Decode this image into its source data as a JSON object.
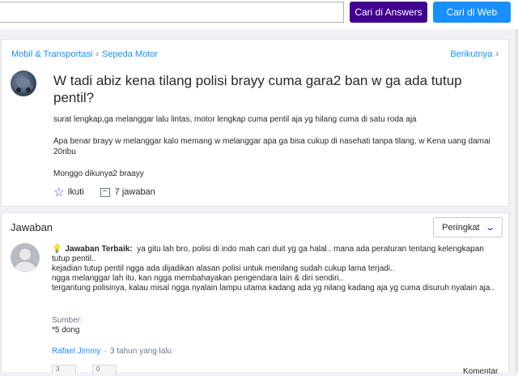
{
  "search": {
    "value": "",
    "answers_button": "Cari di Answers",
    "web_button": "Cari di Web"
  },
  "breadcrumb": {
    "category": "Mobil & Transportasi",
    "subcategory": "Sepeda Motor"
  },
  "next_link": "Berikutnya",
  "question": {
    "title": "W tadi abiz kena tilang polisi brayy cuma gara2 ban w ga ada tutup pentil?",
    "body": [
      "surat lengkap,ga melanggar lalu lintas, motor lengkap cuma pentil aja yg hilang cuma di satu roda aja",
      "Apa benar brayy w melanggar kalo memang w melanggar apa ga bisa cukup di nasehati tanpa tilang, w Kena uang damai 20ribu",
      "Monggo dikunya2 braayy"
    ],
    "follow_label": "Ikuti",
    "answers_count": "7 jawaban"
  },
  "answers": {
    "heading": "Jawaban",
    "sort_label": "Peringkat",
    "best": {
      "label": "Jawaban Terbaik:",
      "lines": [
        "ya gitu lah bro, polisi di indo mah cari duit yg ga halal.. mana ada peraturan tentang kelengkapan tutup pentil..",
        "kejadian tutup pentil ngga ada dijadikan alasan polisi untuk menilang sudah cukup lama terjadi..",
        "ngga melanggar lah itu, kan ngga membahayakan pengendara lain & diri sendiri..",
        "tergantung polisinya, kalau misal ngga nyalain lampu utama kadang ada yg nilang kadang aja yg cuma disuruh nyalain aja.."
      ],
      "source_label": "Sumber:",
      "source_value": "*5 dong",
      "author": "Rafael Jimmy",
      "time": "3 tahun yang lalu",
      "vote_up": "3",
      "vote_down": "0",
      "comment_label": "Komentar"
    }
  },
  "colors": {
    "answers_button": "#400090",
    "web_button": "#188fff",
    "link": "#188fff"
  }
}
